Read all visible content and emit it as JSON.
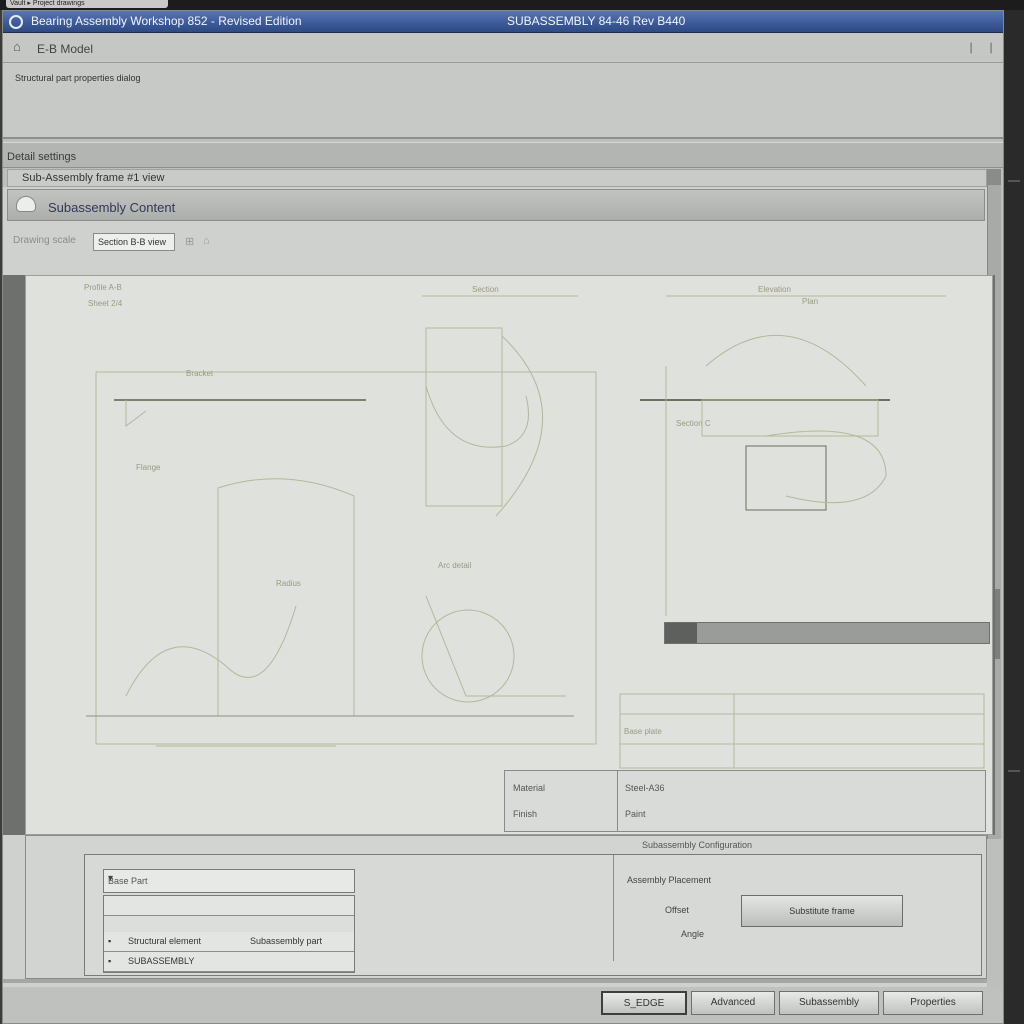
{
  "top_strip": {
    "tab_text": "Vault  ▸ Project drawings"
  },
  "titlebar": {
    "title_left": "Bearing Assembly Workshop 852 - Revised Edition",
    "title_right": "SUBASSEMBLY 84-46 Rev B440"
  },
  "menubar": {
    "label": "E-B  Model",
    "min": "|",
    "close": "|"
  },
  "info_panel": {
    "text": "Structural part properties dialog"
  },
  "section_head": {
    "label": "Detail settings"
  },
  "path_bar": {
    "label": "Sub-Assembly frame #1 view"
  },
  "dialog": {
    "title": "Subassembly Content",
    "toolbar": {
      "label": "Drawing scale",
      "field": "Section B-B view",
      "icon1": "⊞",
      "icon2": "⌂"
    }
  },
  "drawing": {
    "dim_top_left": "Section",
    "dim_top_right": "Elevation",
    "sub_top_right": "Plan",
    "legend_a": "Profile A-B",
    "legend_b": "Sheet 2/4",
    "note_1": "Bracket",
    "note_2": "Flange",
    "note_3": "Radius",
    "note_4": "Arc detail",
    "note_5": "Section C",
    "note_6": "Base plate"
  },
  "progress": {
    "fraction": 0.1
  },
  "props": {
    "k1": "Material",
    "k2": "Finish",
    "v1": "Steel-A36",
    "v2": "Paint"
  },
  "lower_panel": {
    "caption": "Subassembly Configuration",
    "combo_value": "Base Part",
    "list_rows": [
      {
        "icon": "",
        "col1": "",
        "col2": ""
      },
      {
        "icon": "▪",
        "col1": "Structural element",
        "col2": "Subassembly part"
      },
      {
        "icon": "▪",
        "col1": "SUBASSEMBLY",
        "col2": ""
      }
    ],
    "right_title": "Assembly Placement",
    "right_key": "Offset",
    "right_sub": "Angle",
    "apply_label": "Substitute frame"
  },
  "buttons": [
    "S_EDGE",
    "Advanced",
    "Subassembly",
    "Properties"
  ],
  "colors": {
    "titlebar": "#3b5998",
    "canvas": "#dfe1dd",
    "window": "#bdbfbd"
  }
}
